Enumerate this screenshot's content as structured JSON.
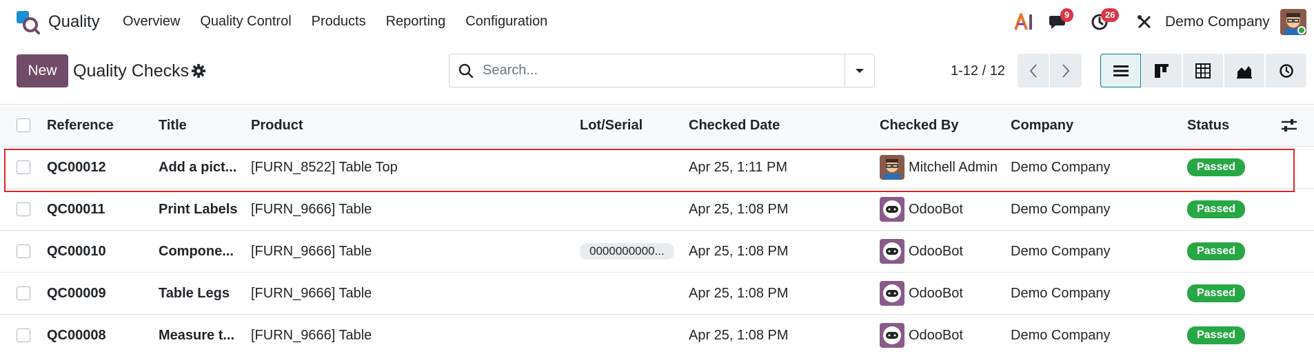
{
  "navbar": {
    "app_name": "Quality",
    "menu": [
      "Overview",
      "Quality Control",
      "Products",
      "Reporting",
      "Configuration"
    ],
    "messages_badge": "9",
    "activities_badge": "26",
    "company": "Demo Company"
  },
  "control_panel": {
    "new_label": "New",
    "title": "Quality Checks",
    "search_placeholder": "Search...",
    "pager": "1-12 / 12"
  },
  "table": {
    "columns": [
      "Reference",
      "Title",
      "Product",
      "Lot/Serial",
      "Checked Date",
      "Checked By",
      "Company",
      "Status"
    ],
    "rows": [
      {
        "reference": "QC00012",
        "title": "Add a pict...",
        "product": "[FURN_8522] Table Top",
        "lot": "",
        "date": "Apr 25, 1:11 PM",
        "user": "Mitchell Admin",
        "company": "Demo Company",
        "status": "Passed"
      },
      {
        "reference": "QC00011",
        "title": "Print Labels",
        "product": "[FURN_9666] Table",
        "lot": "",
        "date": "Apr 25, 1:08 PM",
        "user": "OdooBot",
        "company": "Demo Company",
        "status": "Passed"
      },
      {
        "reference": "QC00010",
        "title": "Compone...",
        "product": "[FURN_9666] Table",
        "lot": "0000000000...",
        "date": "Apr 25, 1:08 PM",
        "user": "OdooBot",
        "company": "Demo Company",
        "status": "Passed"
      },
      {
        "reference": "QC00009",
        "title": "Table Legs",
        "product": "[FURN_9666] Table",
        "lot": "",
        "date": "Apr 25, 1:08 PM",
        "user": "OdooBot",
        "company": "Demo Company",
        "status": "Passed"
      },
      {
        "reference": "QC00008",
        "title": "Measure t...",
        "product": "[FURN_9666] Table",
        "lot": "",
        "date": "Apr 25, 1:08 PM",
        "user": "OdooBot",
        "company": "Demo Company",
        "status": "Passed"
      }
    ]
  },
  "colors": {
    "brand": "#714b67",
    "status_passed": "#28a745",
    "badge": "#dc3545",
    "highlight": "#e02424"
  }
}
